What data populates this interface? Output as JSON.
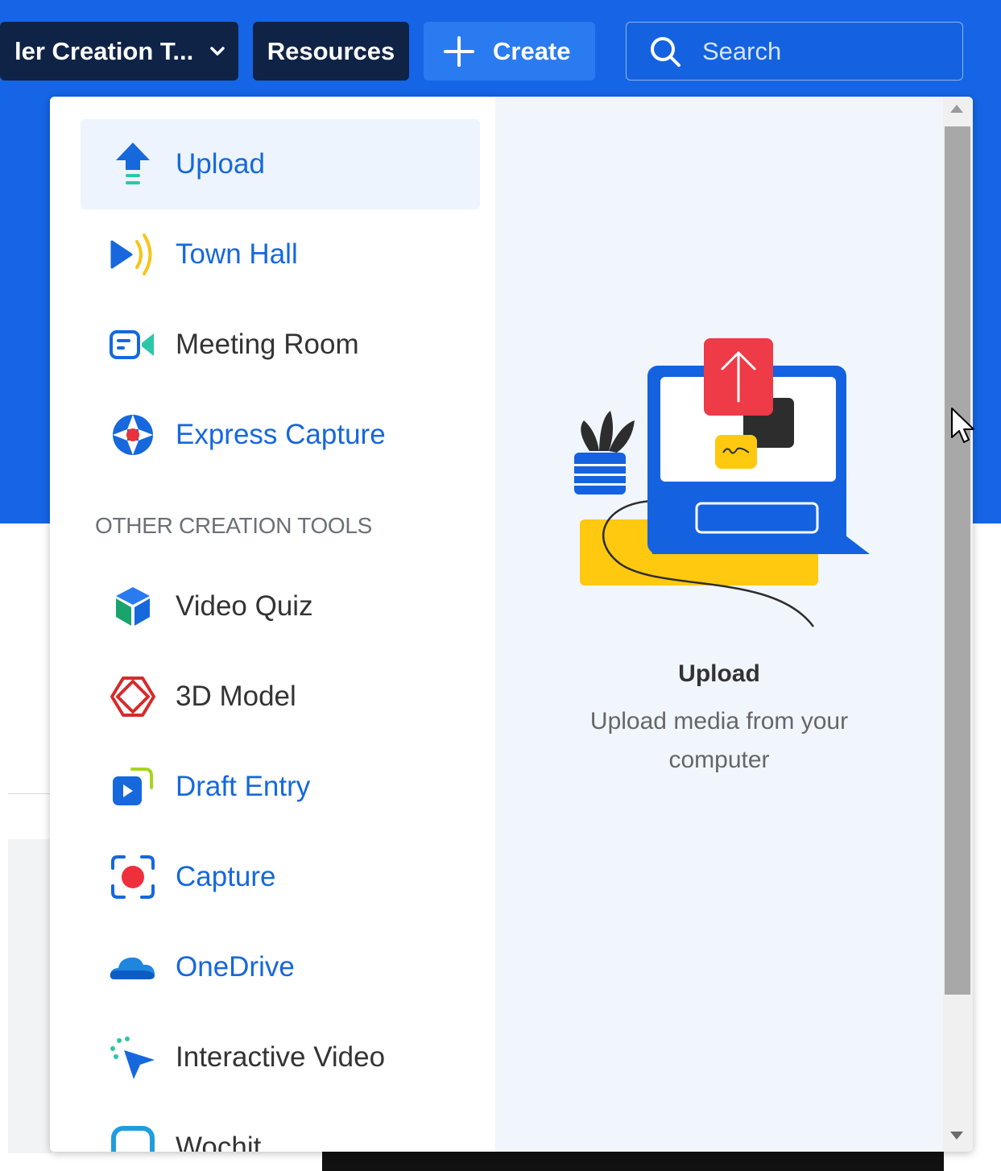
{
  "topbar": {
    "creation_label": "ler Creation T...",
    "resources_label": "Resources",
    "create_label": "Create",
    "search_placeholder": "Search"
  },
  "menu": {
    "primary_items": [
      {
        "label": "Upload",
        "icon": "upload-icon",
        "selected": true
      },
      {
        "label": "Town Hall",
        "icon": "town-hall-icon"
      },
      {
        "label": "Meeting Room",
        "icon": "meeting-room-icon"
      },
      {
        "label": "Express Capture",
        "icon": "express-capture-icon"
      }
    ],
    "section_title": "OTHER CREATION TOOLS",
    "other_items": [
      {
        "label": "Video Quiz",
        "icon": "video-quiz-icon"
      },
      {
        "label": "3D Model",
        "icon": "3d-model-icon"
      },
      {
        "label": "Draft Entry",
        "icon": "draft-entry-icon"
      },
      {
        "label": "Capture",
        "icon": "capture-icon"
      },
      {
        "label": "OneDrive",
        "icon": "onedrive-icon"
      },
      {
        "label": "Interactive Video",
        "icon": "interactive-video-icon"
      },
      {
        "label": "Wochit",
        "icon": "wochit-icon"
      }
    ]
  },
  "preview": {
    "title": "Upload",
    "description": "Upload media from your computer"
  },
  "colors": {
    "brand_blue": "#1565e6",
    "nav_dark": "#0f2347",
    "link_blue": "#1668dc"
  }
}
